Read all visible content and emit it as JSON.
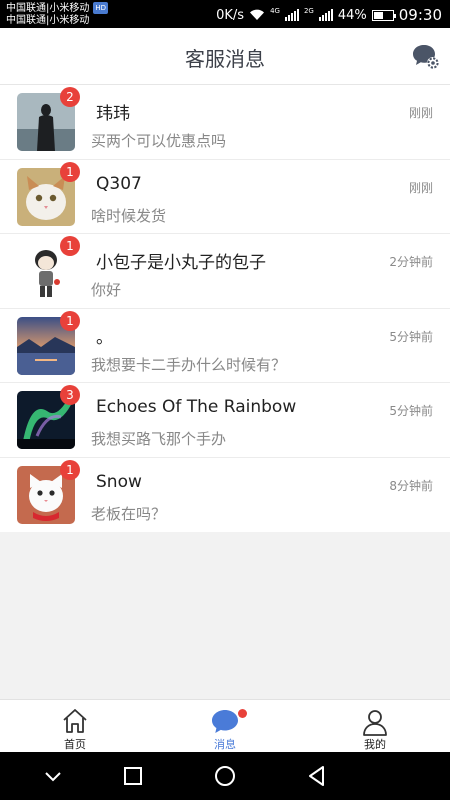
{
  "status_bar": {
    "carrier_line1": "中国联通|小米移动",
    "carrier_line2": "中国联通|小米移动",
    "hd_badge": "HD",
    "speed": "0K/s",
    "net_4g": "4G",
    "net_2g": "2G",
    "battery_percent": "44%",
    "battery_level": 0.44,
    "time": "09:30"
  },
  "header": {
    "title": "客服消息",
    "settings_icon": "chat-gear-icon"
  },
  "conversations": [
    {
      "name": "玮玮",
      "message": "买两个可以优惠点吗",
      "time": "刚刚",
      "unread": "2",
      "avatar": "silhouette-photo"
    },
    {
      "name": "Q307",
      "message": "啥时候发货",
      "time": "刚刚",
      "unread": "1",
      "avatar": "cat-photo"
    },
    {
      "name": "小包子是小丸子的包子",
      "message": "你好",
      "time": "2分钟前",
      "unread": "1",
      "avatar": "cartoon-figure"
    },
    {
      "name": "。",
      "message": "我想要卡二手办什么时候有？",
      "time": "5分钟前",
      "unread": "1",
      "avatar": "sunset-photo"
    },
    {
      "name": "Echoes Of The Rainbow",
      "message": "我想买路飞那个手办",
      "time": "5分钟前",
      "unread": "3",
      "avatar": "aurora-photo"
    },
    {
      "name": "Snow",
      "message": "老板在吗？",
      "time": "8分钟前",
      "unread": "1",
      "avatar": "white-cat-photo"
    }
  ],
  "tabbar": {
    "home_label": "首页",
    "messages_label": "消息",
    "mine_label": "我的",
    "active": "messages",
    "active_color": "#4a7bd8",
    "badge_color": "#e8413a"
  },
  "navbar": {
    "icons": [
      "chevron-down-icon",
      "square-icon",
      "circle-icon",
      "back-triangle-icon"
    ]
  }
}
